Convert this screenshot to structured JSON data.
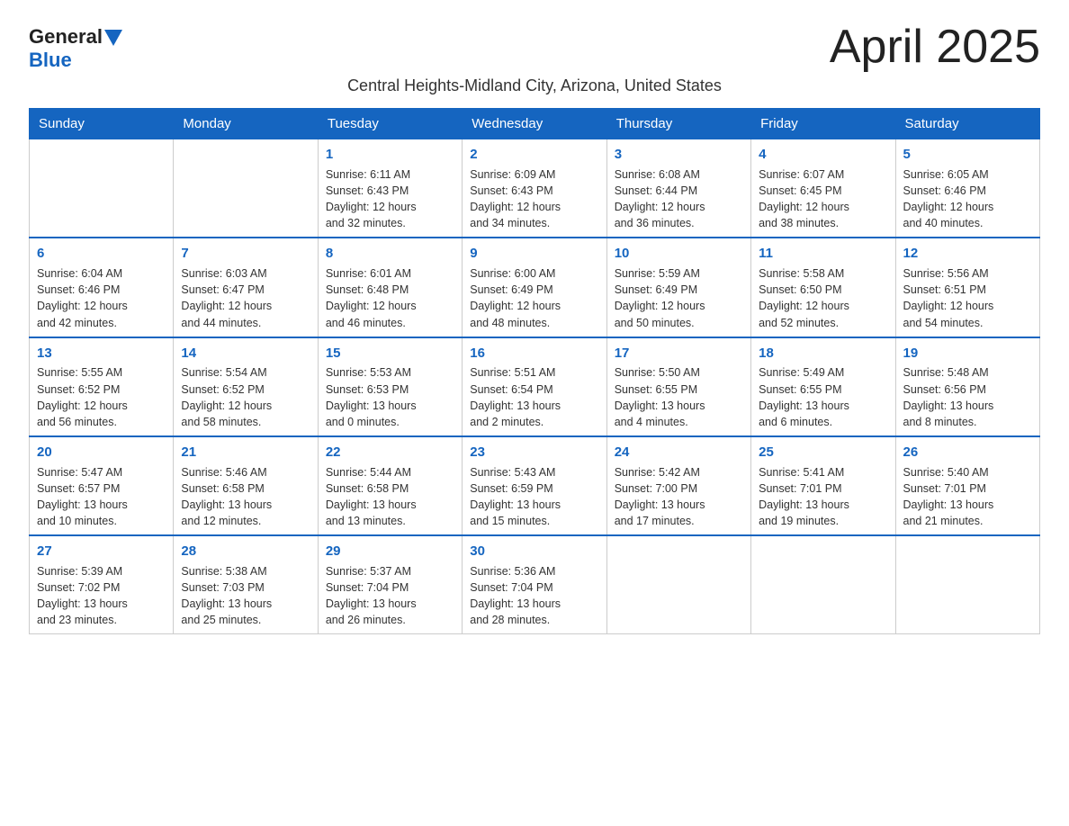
{
  "logo": {
    "part1": "General",
    "part2": "Blue"
  },
  "title": "April 2025",
  "subtitle": "Central Heights-Midland City, Arizona, United States",
  "days_header": [
    "Sunday",
    "Monday",
    "Tuesday",
    "Wednesday",
    "Thursday",
    "Friday",
    "Saturday"
  ],
  "weeks": [
    [
      {
        "day": "",
        "info": ""
      },
      {
        "day": "",
        "info": ""
      },
      {
        "day": "1",
        "info": "Sunrise: 6:11 AM\nSunset: 6:43 PM\nDaylight: 12 hours\nand 32 minutes."
      },
      {
        "day": "2",
        "info": "Sunrise: 6:09 AM\nSunset: 6:43 PM\nDaylight: 12 hours\nand 34 minutes."
      },
      {
        "day": "3",
        "info": "Sunrise: 6:08 AM\nSunset: 6:44 PM\nDaylight: 12 hours\nand 36 minutes."
      },
      {
        "day": "4",
        "info": "Sunrise: 6:07 AM\nSunset: 6:45 PM\nDaylight: 12 hours\nand 38 minutes."
      },
      {
        "day": "5",
        "info": "Sunrise: 6:05 AM\nSunset: 6:46 PM\nDaylight: 12 hours\nand 40 minutes."
      }
    ],
    [
      {
        "day": "6",
        "info": "Sunrise: 6:04 AM\nSunset: 6:46 PM\nDaylight: 12 hours\nand 42 minutes."
      },
      {
        "day": "7",
        "info": "Sunrise: 6:03 AM\nSunset: 6:47 PM\nDaylight: 12 hours\nand 44 minutes."
      },
      {
        "day": "8",
        "info": "Sunrise: 6:01 AM\nSunset: 6:48 PM\nDaylight: 12 hours\nand 46 minutes."
      },
      {
        "day": "9",
        "info": "Sunrise: 6:00 AM\nSunset: 6:49 PM\nDaylight: 12 hours\nand 48 minutes."
      },
      {
        "day": "10",
        "info": "Sunrise: 5:59 AM\nSunset: 6:49 PM\nDaylight: 12 hours\nand 50 minutes."
      },
      {
        "day": "11",
        "info": "Sunrise: 5:58 AM\nSunset: 6:50 PM\nDaylight: 12 hours\nand 52 minutes."
      },
      {
        "day": "12",
        "info": "Sunrise: 5:56 AM\nSunset: 6:51 PM\nDaylight: 12 hours\nand 54 minutes."
      }
    ],
    [
      {
        "day": "13",
        "info": "Sunrise: 5:55 AM\nSunset: 6:52 PM\nDaylight: 12 hours\nand 56 minutes."
      },
      {
        "day": "14",
        "info": "Sunrise: 5:54 AM\nSunset: 6:52 PM\nDaylight: 12 hours\nand 58 minutes."
      },
      {
        "day": "15",
        "info": "Sunrise: 5:53 AM\nSunset: 6:53 PM\nDaylight: 13 hours\nand 0 minutes."
      },
      {
        "day": "16",
        "info": "Sunrise: 5:51 AM\nSunset: 6:54 PM\nDaylight: 13 hours\nand 2 minutes."
      },
      {
        "day": "17",
        "info": "Sunrise: 5:50 AM\nSunset: 6:55 PM\nDaylight: 13 hours\nand 4 minutes."
      },
      {
        "day": "18",
        "info": "Sunrise: 5:49 AM\nSunset: 6:55 PM\nDaylight: 13 hours\nand 6 minutes."
      },
      {
        "day": "19",
        "info": "Sunrise: 5:48 AM\nSunset: 6:56 PM\nDaylight: 13 hours\nand 8 minutes."
      }
    ],
    [
      {
        "day": "20",
        "info": "Sunrise: 5:47 AM\nSunset: 6:57 PM\nDaylight: 13 hours\nand 10 minutes."
      },
      {
        "day": "21",
        "info": "Sunrise: 5:46 AM\nSunset: 6:58 PM\nDaylight: 13 hours\nand 12 minutes."
      },
      {
        "day": "22",
        "info": "Sunrise: 5:44 AM\nSunset: 6:58 PM\nDaylight: 13 hours\nand 13 minutes."
      },
      {
        "day": "23",
        "info": "Sunrise: 5:43 AM\nSunset: 6:59 PM\nDaylight: 13 hours\nand 15 minutes."
      },
      {
        "day": "24",
        "info": "Sunrise: 5:42 AM\nSunset: 7:00 PM\nDaylight: 13 hours\nand 17 minutes."
      },
      {
        "day": "25",
        "info": "Sunrise: 5:41 AM\nSunset: 7:01 PM\nDaylight: 13 hours\nand 19 minutes."
      },
      {
        "day": "26",
        "info": "Sunrise: 5:40 AM\nSunset: 7:01 PM\nDaylight: 13 hours\nand 21 minutes."
      }
    ],
    [
      {
        "day": "27",
        "info": "Sunrise: 5:39 AM\nSunset: 7:02 PM\nDaylight: 13 hours\nand 23 minutes."
      },
      {
        "day": "28",
        "info": "Sunrise: 5:38 AM\nSunset: 7:03 PM\nDaylight: 13 hours\nand 25 minutes."
      },
      {
        "day": "29",
        "info": "Sunrise: 5:37 AM\nSunset: 7:04 PM\nDaylight: 13 hours\nand 26 minutes."
      },
      {
        "day": "30",
        "info": "Sunrise: 5:36 AM\nSunset: 7:04 PM\nDaylight: 13 hours\nand 28 minutes."
      },
      {
        "day": "",
        "info": ""
      },
      {
        "day": "",
        "info": ""
      },
      {
        "day": "",
        "info": ""
      }
    ]
  ]
}
